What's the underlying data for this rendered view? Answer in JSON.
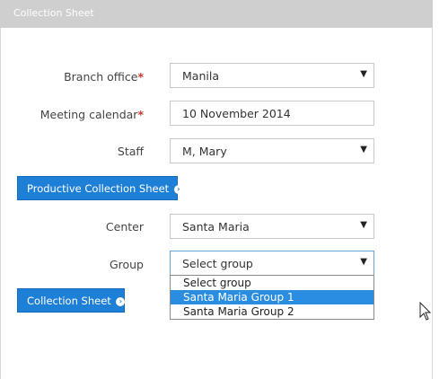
{
  "header": {
    "title": "Collection Sheet"
  },
  "form": {
    "branch_label": "Branch office",
    "branch_value": "Manila",
    "calendar_label": "Meeting calendar",
    "calendar_value": "10 November 2014",
    "staff_label": "Staff",
    "staff_value": "M, Mary",
    "productive_button": "Productive Collection Sheet",
    "center_label": "Center",
    "center_value": "Santa Maria",
    "group_label": "Group",
    "group_value": "Select group",
    "required_mark": "*",
    "collection_button": "Collection Sheet"
  },
  "group_options": [
    "Select group",
    "Santa Maria Group 1",
    "Santa Maria Group 2"
  ],
  "group_highlighted_index": 1,
  "colors": {
    "button": "#1d7fd6",
    "header": "#cfcfcf",
    "highlight": "#2b8de0",
    "required": "#c0392b"
  }
}
